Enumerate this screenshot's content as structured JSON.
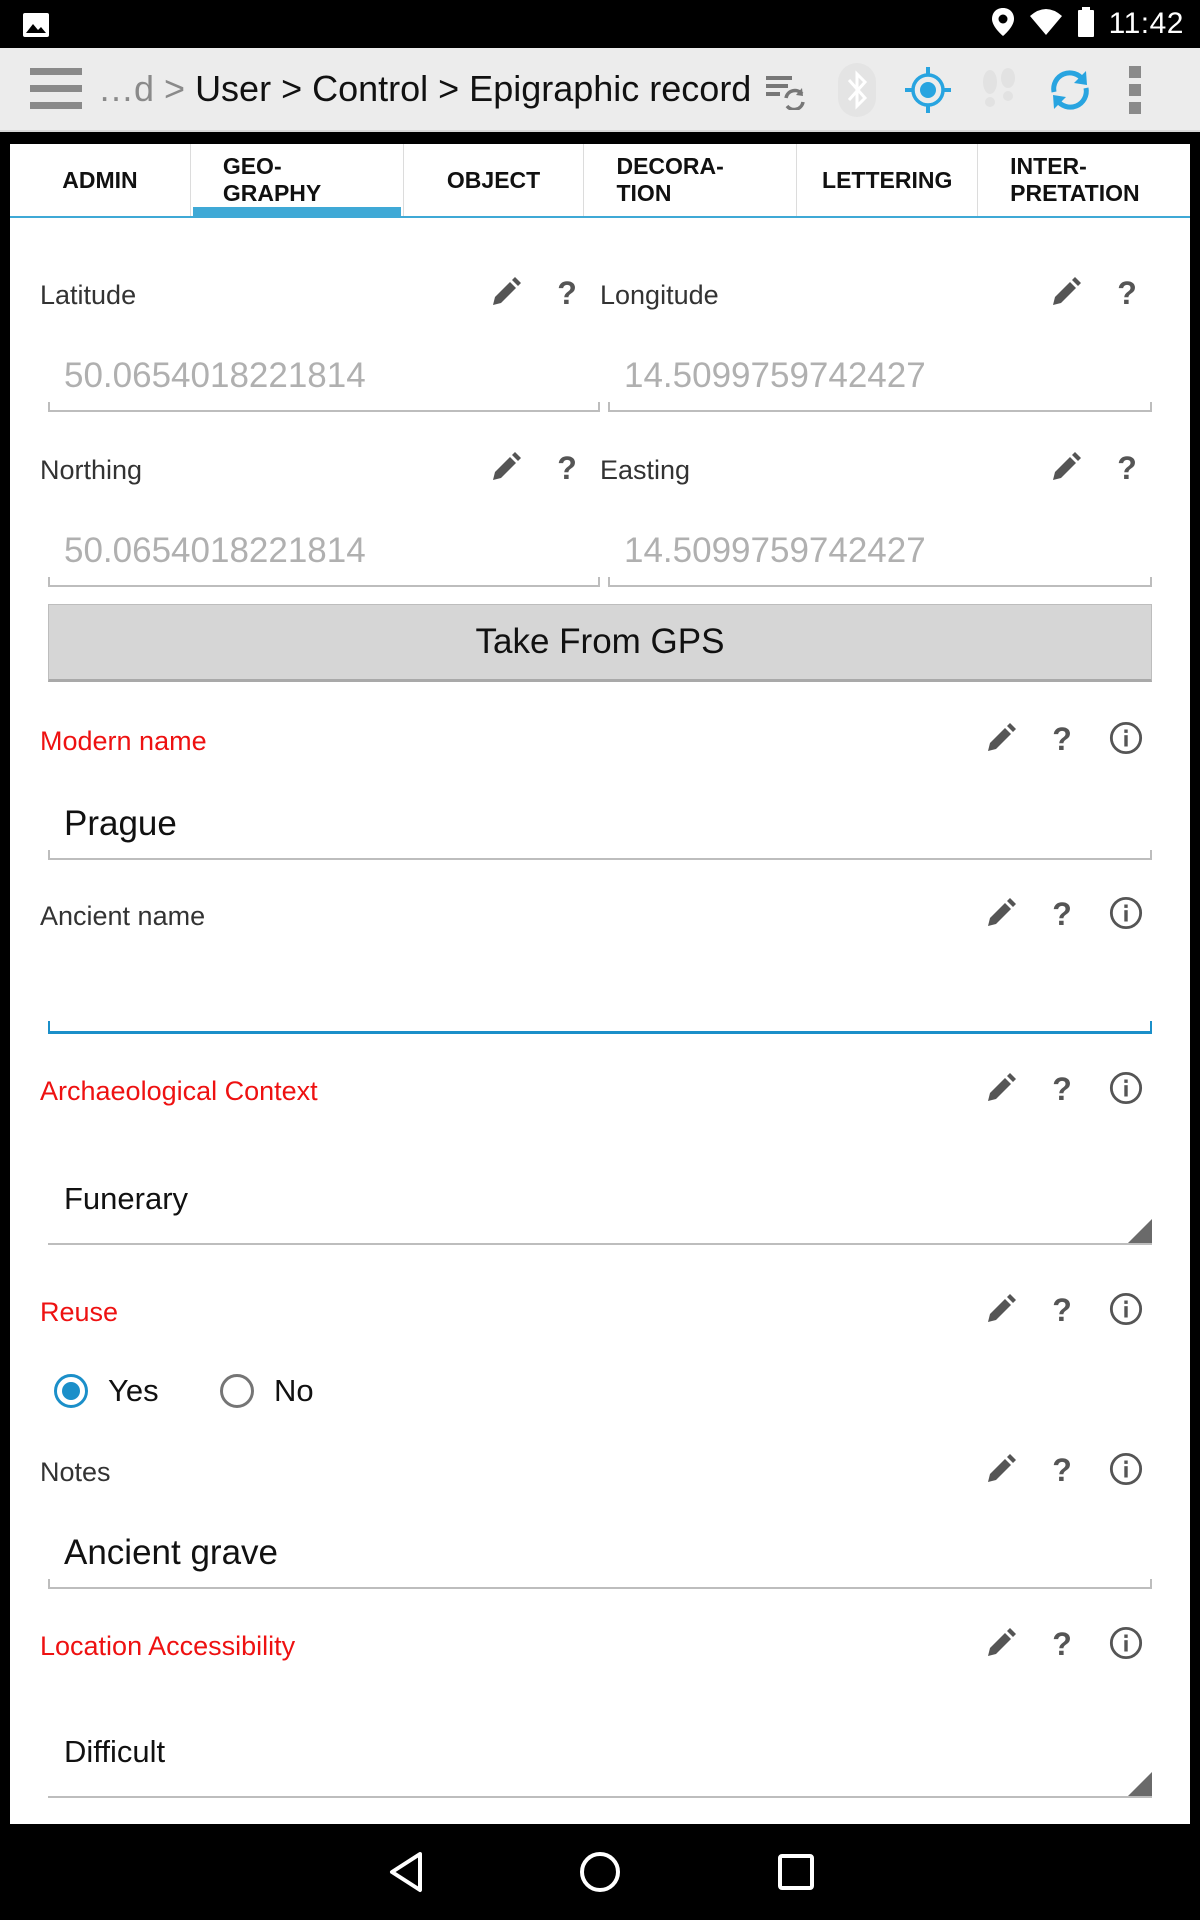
{
  "status_bar": {
    "time": "11:42",
    "icons": [
      "photo-icon",
      "location-icon",
      "wifi-icon",
      "battery-icon"
    ]
  },
  "action_bar": {
    "breadcrumb_prefix": "…d >",
    "breadcrumb": "User > Control > Epigraphic record",
    "icons": [
      "sync-list-icon",
      "bluetooth-icon",
      "gps-target-icon",
      "footsteps-icon",
      "refresh-icon",
      "overflow-menu-icon"
    ]
  },
  "tabs": [
    {
      "label": "ADMIN",
      "active": false
    },
    {
      "label": "GEO-\nGRAPHY",
      "active": true
    },
    {
      "label": "OBJECT",
      "active": false
    },
    {
      "label": "DECORA-\nTION",
      "active": false
    },
    {
      "label": "LETTERING",
      "active": false
    },
    {
      "label": "INTER-\nPRETATION",
      "active": false
    }
  ],
  "form": {
    "latitude": {
      "label": "Latitude",
      "hint": "50.0654018221814"
    },
    "longitude": {
      "label": "Longitude",
      "hint": "14.5099759742427"
    },
    "northing": {
      "label": "Northing",
      "hint": "50.0654018221814"
    },
    "easting": {
      "label": "Easting",
      "hint": "14.5099759742427"
    },
    "gps_button": "Take From GPS",
    "modern_name": {
      "label": "Modern name",
      "value": "Prague",
      "required": true
    },
    "ancient_name": {
      "label": "Ancient name",
      "value": "",
      "required": false
    },
    "archaeological_context": {
      "label": "Archaeological Context",
      "value": "Funerary",
      "required": true
    },
    "reuse": {
      "label": "Reuse",
      "options": [
        "Yes",
        "No"
      ],
      "selected": "Yes",
      "required": true
    },
    "notes": {
      "label": "Notes",
      "value": "Ancient grave",
      "required": false
    },
    "location_accessibility": {
      "label": "Location Accessibility",
      "value": "Difficult",
      "required": true
    },
    "help_glyph": "?"
  },
  "colors": {
    "accent": "#1b8fc9",
    "tab_indicator": "#3fa9d6",
    "required_label": "#ee1111",
    "hint_text": "#b0b0b0"
  },
  "nav_bar": {
    "icons": [
      "back-icon",
      "home-icon",
      "recents-icon"
    ]
  }
}
